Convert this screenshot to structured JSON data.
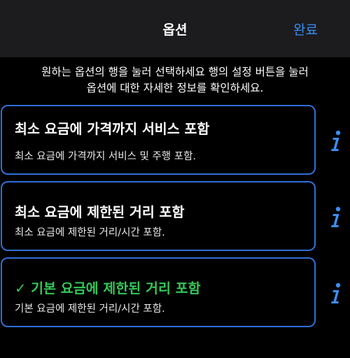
{
  "nav": {
    "title": "옵션",
    "done_label": "완료"
  },
  "instructions": {
    "line1": "원하는 옵션의 행을 눌러 선택하세요 행의 설정 버튼을 눌러",
    "line2": "옵션에 대한 자세한 정보를 확인하세요."
  },
  "options": [
    {
      "title": "최소 요금에 가격까지 서비스 포함",
      "description": "최소 요금에 가격까지 서비스 및 주행 포함.",
      "selected": false
    },
    {
      "title": "최소 요금에 제한된 거리 포함",
      "description": "최소 요금에 제한된 거리/시간 포함.",
      "selected": false
    },
    {
      "title": "✓ 기본 요금에 제한된 거리 포함",
      "description": "기본 요금에 제한된 거리/시간 포함.",
      "selected": true
    }
  ],
  "colors": {
    "accent": "#3a8ef6",
    "row_border": "#2f6fd8",
    "selected_text": "#35c759",
    "nav_background": "#1c1c1e"
  },
  "icons": {
    "info": "info-icon",
    "checkmark": "checkmark-icon"
  }
}
